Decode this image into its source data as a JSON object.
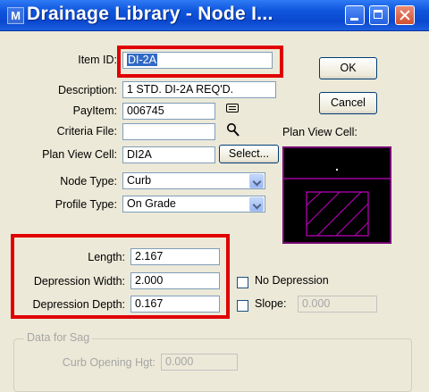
{
  "window": {
    "title": "Drainage Library - Node I...",
    "app_icon": "microstation-icon"
  },
  "form": {
    "item_id": {
      "label": "Item ID:",
      "value": "DI-2A"
    },
    "description": {
      "label": "Description:",
      "value": "1 STD. DI-2A REQ'D."
    },
    "pay_item": {
      "label": "PayItem:",
      "value": "006745"
    },
    "criteria_file": {
      "label": "Criteria File:",
      "value": ""
    },
    "plan_view_cell": {
      "label": "Plan View Cell:",
      "value": "DI2A"
    },
    "node_type": {
      "label": "Node Type:",
      "value": "Curb"
    },
    "profile_type": {
      "label": "Profile Type:",
      "value": "On Grade"
    },
    "length": {
      "label": "Length:",
      "value": "2.167"
    },
    "depression_width": {
      "label": "Depression Width:",
      "value": "2.000"
    },
    "depression_depth": {
      "label": "Depression Depth:",
      "value": "0.167"
    },
    "slope": {
      "label": "Slope:",
      "value": "0.000"
    },
    "no_depression": {
      "label": "No Depression",
      "checked": false
    },
    "slope_check": {
      "checked": false
    }
  },
  "buttons": {
    "ok": "OK",
    "cancel": "Cancel",
    "select": "Select..."
  },
  "preview": {
    "label": "Plan View Cell:"
  },
  "sag": {
    "legend": "Data for Sag",
    "curb_opening_hgt": {
      "label": "Curb Opening Hgt:",
      "value": "0.000"
    }
  },
  "colors": {
    "highlight_box": "#e00000",
    "cell_drawing": "#c000c0",
    "title_bar": "#0a48cf"
  }
}
